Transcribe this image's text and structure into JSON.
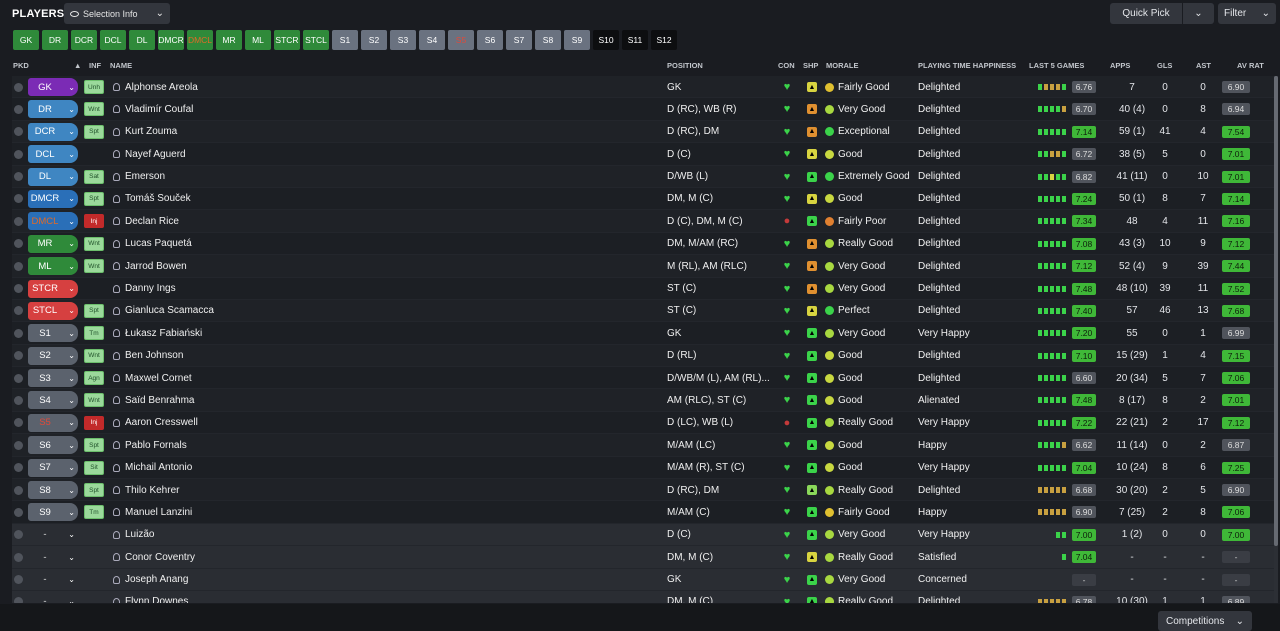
{
  "header": {
    "title": "PLAYERS",
    "selection_info": "Selection Info",
    "quick_pick": "Quick Pick",
    "filter": "Filter"
  },
  "position_buttons": [
    {
      "label": "GK",
      "style": "green"
    },
    {
      "label": "DR",
      "style": "green"
    },
    {
      "label": "DCR",
      "style": "green"
    },
    {
      "label": "DCL",
      "style": "green"
    },
    {
      "label": "DL",
      "style": "green"
    },
    {
      "label": "DMCR",
      "style": "green"
    },
    {
      "label": "DMCL",
      "style": "green orange-txt"
    },
    {
      "label": "MR",
      "style": "green"
    },
    {
      "label": "ML",
      "style": "green"
    },
    {
      "label": "STCR",
      "style": "green"
    },
    {
      "label": "STCL",
      "style": "green"
    },
    {
      "label": "S1",
      "style": "grey"
    },
    {
      "label": "S2",
      "style": "grey"
    },
    {
      "label": "S3",
      "style": "grey"
    },
    {
      "label": "S4",
      "style": "grey"
    },
    {
      "label": "S5",
      "style": "grey red-txt"
    },
    {
      "label": "S6",
      "style": "grey"
    },
    {
      "label": "S7",
      "style": "grey"
    },
    {
      "label": "S8",
      "style": "grey"
    },
    {
      "label": "S9",
      "style": "grey"
    },
    {
      "label": "S10",
      "style": "dark"
    },
    {
      "label": "S11",
      "style": "dark"
    },
    {
      "label": "S12",
      "style": "dark"
    }
  ],
  "columns": {
    "pkd": "PKD",
    "inf": "INF",
    "name": "NAME",
    "position": "POSITION",
    "con": "CON",
    "shp": "SHP",
    "morale": "MORALE",
    "pth": "PLAYING TIME HAPPINESS",
    "last5": "LAST 5 GAMES",
    "apps": "APPS",
    "gls": "GLS",
    "ast": "AST",
    "avrat": "AV RAT"
  },
  "players": [
    {
      "pos": "GK",
      "tag": "gk",
      "inf": "Unh",
      "name": "Alphonse Areola",
      "position": "GK",
      "con": "green",
      "shp": "y",
      "morale": "Fairly Good",
      "md": "fg",
      "pth": "Delighted",
      "form": "gooog",
      "l5": "6.76",
      "l5c": "grey",
      "apps": "7",
      "gls": "0",
      "ast": "0",
      "av": "6.90",
      "avc": "grey"
    },
    {
      "pos": "DR",
      "tag": "def",
      "inf": "Wnt",
      "name": "Vladimír Coufal",
      "position": "D (RC), WB (R)",
      "con": "green",
      "shp": "o",
      "morale": "Very Good",
      "md": "vg",
      "pth": "Delighted",
      "form": "ggggo",
      "l5": "6.70",
      "l5c": "grey",
      "apps": "40 (4)",
      "gls": "0",
      "ast": "8",
      "av": "6.94",
      "avc": "grey"
    },
    {
      "pos": "DCR",
      "tag": "def",
      "inf": "Spt",
      "name": "Kurt Zouma",
      "position": "D (RC), DM",
      "con": "green",
      "shp": "o",
      "morale": "Exceptional",
      "md": "ex",
      "pth": "Delighted",
      "form": "ggggg",
      "l5": "7.14",
      "l5c": "green",
      "apps": "59 (1)",
      "gls": "41",
      "ast": "4",
      "av": "7.54",
      "avc": "green"
    },
    {
      "pos": "DCL",
      "tag": "def",
      "inf": "",
      "name": "Nayef Aguerd",
      "position": "D (C)",
      "con": "green",
      "shp": "y",
      "morale": "Good",
      "md": "gd",
      "pth": "Delighted",
      "form": "ggoog",
      "l5": "6.72",
      "l5c": "grey",
      "apps": "38 (5)",
      "gls": "5",
      "ast": "0",
      "av": "7.01",
      "avc": "green"
    },
    {
      "pos": "DL",
      "tag": "def",
      "inf": "Sat",
      "name": "Emerson",
      "position": "D/WB (L)",
      "con": "green",
      "shp": "g",
      "morale": "Extremely Good",
      "md": "ex",
      "pth": "Delighted",
      "form": "ggygg",
      "l5": "6.82",
      "l5c": "grey",
      "apps": "41 (11)",
      "gls": "0",
      "ast": "10",
      "av": "7.01",
      "avc": "green"
    },
    {
      "pos": "DMCR",
      "tag": "dm",
      "inf": "Spt",
      "name": "Tomáš Souček",
      "position": "DM, M (C)",
      "con": "green",
      "shp": "y",
      "morale": "Good",
      "md": "gd",
      "pth": "Delighted",
      "form": "ggggg",
      "l5": "7.24",
      "l5c": "green",
      "apps": "50 (1)",
      "gls": "8",
      "ast": "7",
      "av": "7.14",
      "avc": "green"
    },
    {
      "pos": "DMCL",
      "tag": "dm oratxt",
      "inf": "Inj",
      "name": "Declan Rice",
      "position": "D (C), DM, M (C)",
      "con": "red",
      "shp": "g",
      "morale": "Fairly Poor",
      "md": "fp",
      "pth": "Delighted",
      "form": "ggggg",
      "l5": "7.34",
      "l5c": "green",
      "apps": "48",
      "gls": "4",
      "ast": "11",
      "av": "7.16",
      "avc": "green"
    },
    {
      "pos": "MR",
      "tag": "mid",
      "inf": "Wnt",
      "name": "Lucas Paquetá",
      "position": "DM, M/AM (RC)",
      "con": "green",
      "shp": "o",
      "morale": "Really Good",
      "md": "vg",
      "pth": "Delighted",
      "form": "ggggg",
      "l5": "7.08",
      "l5c": "green",
      "apps": "43 (3)",
      "gls": "10",
      "ast": "9",
      "av": "7.12",
      "avc": "green"
    },
    {
      "pos": "ML",
      "tag": "mid",
      "inf": "Wnt",
      "name": "Jarrod Bowen",
      "position": "M (RL), AM (RLC)",
      "con": "green",
      "shp": "o",
      "morale": "Very Good",
      "md": "vg",
      "pth": "Delighted",
      "form": "ggggg",
      "l5": "7.12",
      "l5c": "green",
      "apps": "52 (4)",
      "gls": "9",
      "ast": "39",
      "av": "7.44",
      "avc": "green"
    },
    {
      "pos": "STCR",
      "tag": "st",
      "inf": "",
      "name": "Danny Ings",
      "position": "ST (C)",
      "con": "green",
      "shp": "o",
      "morale": "Very Good",
      "md": "vg",
      "pth": "Delighted",
      "form": "ggggg",
      "l5": "7.48",
      "l5c": "green",
      "apps": "48 (10)",
      "gls": "39",
      "ast": "11",
      "av": "7.52",
      "avc": "green"
    },
    {
      "pos": "STCL",
      "tag": "st",
      "inf": "Spt",
      "name": "Gianluca Scamacca",
      "position": "ST (C)",
      "con": "green",
      "shp": "y",
      "morale": "Perfect",
      "md": "ex",
      "pth": "Delighted",
      "form": "ggggg",
      "l5": "7.40",
      "l5c": "green",
      "apps": "57",
      "gls": "46",
      "ast": "13",
      "av": "7.68",
      "avc": "green"
    },
    {
      "pos": "S1",
      "tag": "sub",
      "inf": "Tm",
      "name": "Łukasz Fabiański",
      "position": "GK",
      "con": "green",
      "shp": "g",
      "morale": "Very Good",
      "md": "vg",
      "pth": "Very Happy",
      "form": "ggggg",
      "l5": "7.20",
      "l5c": "green",
      "apps": "55",
      "gls": "0",
      "ast": "1",
      "av": "6.99",
      "avc": "grey"
    },
    {
      "pos": "S2",
      "tag": "sub",
      "inf": "Wnt",
      "name": "Ben Johnson",
      "position": "D (RL)",
      "con": "green",
      "shp": "g",
      "morale": "Good",
      "md": "gd",
      "pth": "Delighted",
      "form": "ggggg",
      "l5": "7.10",
      "l5c": "green",
      "apps": "15 (29)",
      "gls": "1",
      "ast": "4",
      "av": "7.15",
      "avc": "green"
    },
    {
      "pos": "S3",
      "tag": "sub",
      "inf": "Agn",
      "name": "Maxwel Cornet",
      "position": "D/WB/M (L), AM (RL)...",
      "con": "green",
      "shp": "g",
      "morale": "Good",
      "md": "gd",
      "pth": "Delighted",
      "form": "ggggg",
      "l5": "6.60",
      "l5c": "grey",
      "apps": "20 (34)",
      "gls": "5",
      "ast": "7",
      "av": "7.06",
      "avc": "green"
    },
    {
      "pos": "S4",
      "tag": "sub",
      "inf": "Wnt",
      "name": "Saïd Benrahma",
      "position": "AM (RLC), ST (C)",
      "con": "green",
      "shp": "g",
      "morale": "Good",
      "md": "gd",
      "pth": "Alienated",
      "form": "ggggg",
      "l5": "7.48",
      "l5c": "green",
      "apps": "8 (17)",
      "gls": "8",
      "ast": "2",
      "av": "7.01",
      "avc": "green"
    },
    {
      "pos": "S5",
      "tag": "sub redtxt",
      "inf": "Inj",
      "name": "Aaron Cresswell",
      "position": "D (LC), WB (L)",
      "con": "red",
      "shp": "g",
      "morale": "Really Good",
      "md": "vg",
      "pth": "Very Happy",
      "form": "ggggg",
      "l5": "7.22",
      "l5c": "green",
      "apps": "22 (21)",
      "gls": "2",
      "ast": "17",
      "av": "7.12",
      "avc": "green"
    },
    {
      "pos": "S6",
      "tag": "sub",
      "inf": "Spt",
      "name": "Pablo Fornals",
      "position": "M/AM (LC)",
      "con": "green",
      "shp": "g",
      "morale": "Good",
      "md": "gd",
      "pth": "Happy",
      "form": "ggggo",
      "l5": "6.62",
      "l5c": "grey",
      "apps": "11 (14)",
      "gls": "0",
      "ast": "2",
      "av": "6.87",
      "avc": "grey"
    },
    {
      "pos": "S7",
      "tag": "sub",
      "inf": "Sit",
      "name": "Michail Antonio",
      "position": "M/AM (R), ST (C)",
      "con": "green",
      "shp": "g",
      "morale": "Good",
      "md": "gd",
      "pth": "Very Happy",
      "form": "ggggg",
      "l5": "7.04",
      "l5c": "green",
      "apps": "10 (24)",
      "gls": "8",
      "ast": "6",
      "av": "7.25",
      "avc": "green"
    },
    {
      "pos": "S8",
      "tag": "sub",
      "inf": "Spt",
      "name": "Thilo Kehrer",
      "position": "D (RC), DM",
      "con": "green",
      "shp": "lg",
      "morale": "Really Good",
      "md": "vg",
      "pth": "Delighted",
      "form": "ooooo",
      "l5": "6.68",
      "l5c": "grey",
      "apps": "30 (20)",
      "gls": "2",
      "ast": "5",
      "av": "6.90",
      "avc": "grey"
    },
    {
      "pos": "S9",
      "tag": "sub",
      "inf": "Tm",
      "name": "Manuel Lanzini",
      "position": "M/AM (C)",
      "con": "green",
      "shp": "g",
      "morale": "Fairly Good",
      "md": "fg",
      "pth": "Happy",
      "form": "ooooo",
      "l5": "6.90",
      "l5c": "grey",
      "apps": "7 (25)",
      "gls": "2",
      "ast": "8",
      "av": "7.06",
      "avc": "green"
    },
    {
      "pos": "-",
      "tag": "none",
      "inf": "",
      "name": "Luizão",
      "position": "D (C)",
      "con": "green",
      "shp": "g",
      "morale": "Very Good",
      "md": "vg",
      "pth": "Very Happy",
      "form": "gg",
      "l5": "7.00",
      "l5c": "green",
      "apps": "1 (2)",
      "gls": "0",
      "ast": "0",
      "av": "7.00",
      "avc": "green"
    },
    {
      "pos": "-",
      "tag": "none",
      "inf": "",
      "name": "Conor Coventry",
      "position": "DM, M (C)",
      "con": "green",
      "shp": "y",
      "morale": "Really Good",
      "md": "vg",
      "pth": "Satisfied",
      "form": "g",
      "l5": "7.04",
      "l5c": "green",
      "apps": "-",
      "gls": "-",
      "ast": "-",
      "av": "-",
      "avc": "dash"
    },
    {
      "pos": "-",
      "tag": "none",
      "inf": "",
      "name": "Joseph Anang",
      "position": "GK",
      "con": "green",
      "shp": "g",
      "morale": "Very Good",
      "md": "vg",
      "pth": "Concerned",
      "form": "",
      "l5": "-",
      "l5c": "dash",
      "apps": "-",
      "gls": "-",
      "ast": "-",
      "av": "-",
      "avc": "dash"
    },
    {
      "pos": "-",
      "tag": "none",
      "inf": "",
      "name": "Flynn Downes",
      "position": "DM, M (C)",
      "con": "green",
      "shp": "g",
      "morale": "Really Good",
      "md": "vg",
      "pth": "Delighted",
      "form": "ooooo",
      "l5": "6.78",
      "l5c": "grey",
      "apps": "10 (30)",
      "gls": "1",
      "ast": "1",
      "av": "6.89",
      "avc": "grey"
    }
  ],
  "footer": {
    "competitions": "Competitions"
  }
}
